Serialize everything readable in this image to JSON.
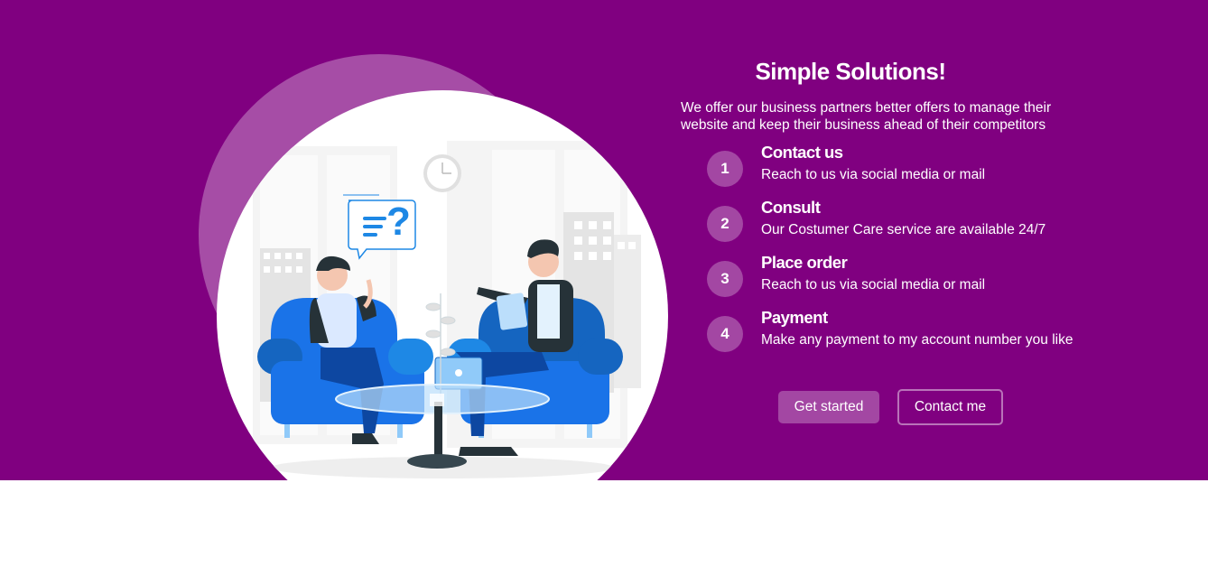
{
  "hero": {
    "title": "Simple Solutions!",
    "intro": "We offer our business partners better offers to manage their website and keep their business ahead of their competitors",
    "steps": [
      {
        "number": "1",
        "title": "Contact us",
        "text": "Reach to us via social media or mail"
      },
      {
        "number": "2",
        "title": "Consult",
        "text": "Our Costumer Care service are available 24/7"
      },
      {
        "number": "3",
        "title": "Place order",
        "text": "Reach to us via social media or mail"
      },
      {
        "number": "4",
        "title": "Payment",
        "text": "Make any payment to my account number you like"
      }
    ],
    "buttons": {
      "primary_label": "Get started",
      "secondary_label": "Contact me"
    },
    "illustration": {
      "icon": "consultation-illustration",
      "bubble_glyph": "?"
    }
  },
  "colors": {
    "hero_background": "#800080",
    "sofa_blue": "#1a73e8",
    "accent_blue": "#1e88e5"
  }
}
